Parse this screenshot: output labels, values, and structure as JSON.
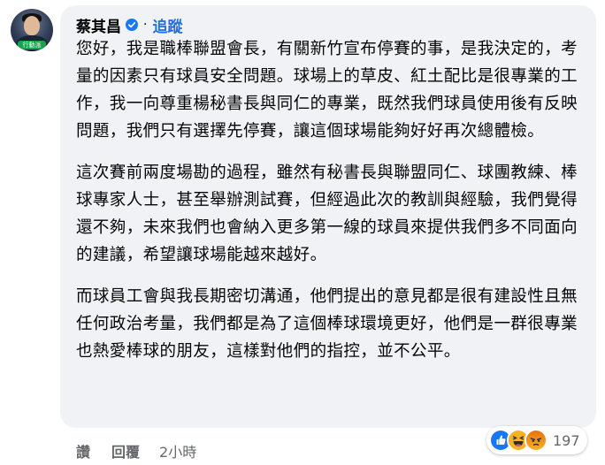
{
  "comment": {
    "author": "蔡其昌",
    "separator": "·",
    "follow_label": "追蹤",
    "avatar_tag": "行動派",
    "paragraphs": [
      "您好，我是職棒聯盟會長，有關新竹宣布停賽的事，是我決定的，考量的因素只有球員安全問題。球場上的草皮、紅土配比是很專業的工作，我一向尊重楊秘書長與同仁的專業，既然我們球員使用後有反映問題，我們只有選擇先停賽，讓這個球場能夠好好再次總體檢。",
      "這次賽前兩度場勘的過程，雖然有秘書長與聯盟同仁、球團教練、棒球專家人士，甚至舉辦測試賽，但經過此次的教訓與經驗，我們覺得還不夠，未來我們也會納入更多第一線的球員來提供我們多不同面向的建議，希望讓球場能越來越好。",
      "而球員工會與我長期密切溝通，他們提出的意見都是很有建設性且無任何政治考量，我們都是為了這個棒球環境更好，他們是一群很專業也熱愛棒球的朋友，這樣對他們的指控，並不公平。"
    ]
  },
  "actions": {
    "like_label": "讚",
    "reply_label": "回覆",
    "time": "2小時"
  },
  "reactions": {
    "icons": [
      "like-icon",
      "haha-icon",
      "angry-icon"
    ],
    "count": "197"
  },
  "colors": {
    "bubble_bg": "#f0f2f5",
    "link_blue": "#216fdb",
    "verified_blue": "#1877f2",
    "meta_gray": "#65676b",
    "like_blue": "#1877f2",
    "haha_yellow": "#f7b125",
    "angry_orange": "#e9710f"
  }
}
